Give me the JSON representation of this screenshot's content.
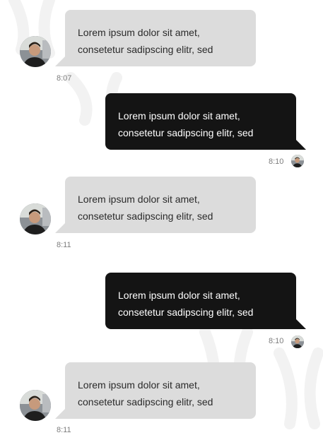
{
  "messages": [
    {
      "direction": "incoming",
      "line1": "Lorem ipsum dolor sit amet,",
      "line2": "consetetur sadipscing elitr, sed",
      "time": "8:07"
    },
    {
      "direction": "outgoing",
      "line1": "Lorem ipsum dolor sit amet,",
      "line2": "consetetur sadipscing elitr, sed",
      "time": "8:10"
    },
    {
      "direction": "incoming",
      "line1": "Lorem ipsum dolor sit amet,",
      "line2": "consetetur sadipscing elitr, sed",
      "time": "8:11"
    },
    {
      "direction": "outgoing",
      "line1": "Lorem ipsum dolor sit amet,",
      "line2": "consetetur sadipscing elitr, sed",
      "time": "8:10"
    },
    {
      "direction": "incoming",
      "line1": "Lorem ipsum dolor sit amet,",
      "line2": "consetetur sadipscing elitr, sed",
      "time": "8:11"
    }
  ],
  "colors": {
    "incoming_bubble": "#dcdcdc",
    "outgoing_bubble": "#141414",
    "incoming_text": "#2a2a2a",
    "outgoing_text": "#ffffff",
    "timestamp": "#7d7d7d"
  },
  "icons": {
    "avatar": "user-avatar-photo"
  }
}
